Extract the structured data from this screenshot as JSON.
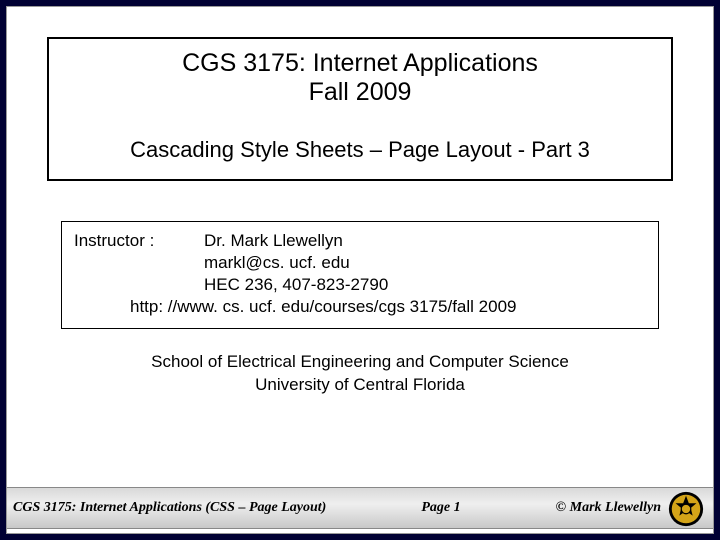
{
  "title": {
    "line1": "CGS 3175: Internet Applications",
    "line2": "Fall 2009",
    "subtitle": "Cascading Style Sheets – Page Layout  - Part 3"
  },
  "instructor": {
    "label": "Instructor :",
    "name": "Dr. Mark Llewellyn",
    "email": "markl@cs. ucf. edu",
    "office": "HEC 236, 407-823-2790",
    "url": "http: //www. cs. ucf. edu/courses/cgs 3175/fall 2009"
  },
  "school": {
    "line1": "School of Electrical Engineering and Computer Science",
    "line2": "University of Central Florida"
  },
  "footer": {
    "left": "CGS 3175: Internet Applications (CSS – Page Layout)",
    "center": "Page 1",
    "right": "© Mark Llewellyn"
  }
}
